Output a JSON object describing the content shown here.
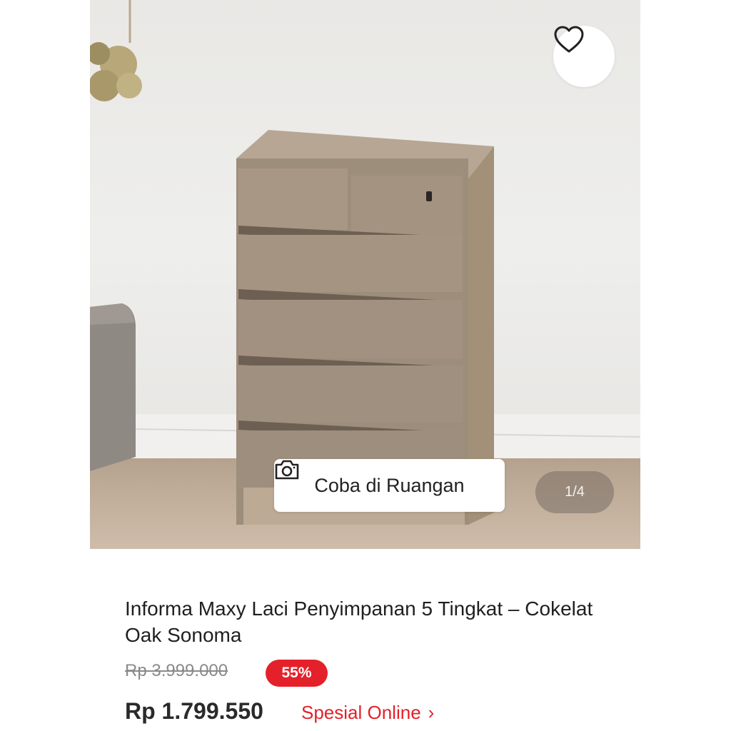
{
  "gallery": {
    "try_in_room_label": "Coba di Ruangan",
    "counter": "1/4",
    "icons": [
      "heart-outline-icon",
      "camera-icon"
    ]
  },
  "product": {
    "title": "Informa Maxy Laci Penyimpanan 5 Tingkat – Cokelat Oak Sonoma",
    "old_price": "Rp 3.999.000",
    "discount": "55%",
    "price": "Rp 1.799.550",
    "special_label": "Spesial Online",
    "special_chevron": "›"
  },
  "colors": {
    "accent_red": "#e4212a",
    "text_dark": "#1f1f1f",
    "text_muted": "#8a8a8a"
  }
}
